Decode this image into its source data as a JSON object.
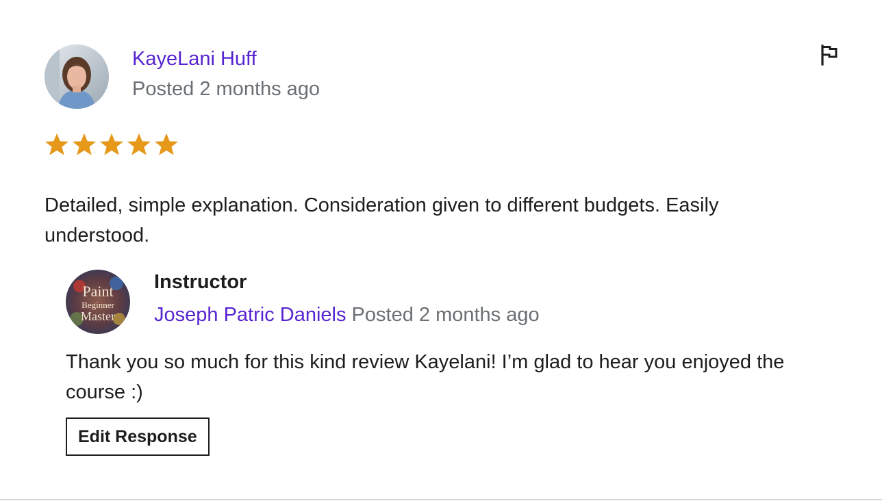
{
  "review": {
    "reviewer_name": "KayeLani Huff",
    "posted": "Posted 2 months ago",
    "rating": 5,
    "rating_max": 5,
    "text": "Detailed, simple explanation. Consideration given to different budgets. Easily understood.",
    "flag_icon": "flag-icon"
  },
  "response": {
    "role": "Instructor",
    "instructor_name": "Joseph Patric Daniels",
    "posted": " Posted 2 months ago",
    "avatar_logo_text": [
      "Paint",
      "Beginner",
      "Master"
    ],
    "text": "Thank you so much for this kind review Kayelani! I’m glad to hear you enjoyed the course :)",
    "edit_button_label": "Edit Response"
  },
  "colors": {
    "link": "#5624d0",
    "muted": "#6a6f73",
    "star": "#e59819",
    "text": "#1c1d1f",
    "divider": "#d1d7dc"
  }
}
